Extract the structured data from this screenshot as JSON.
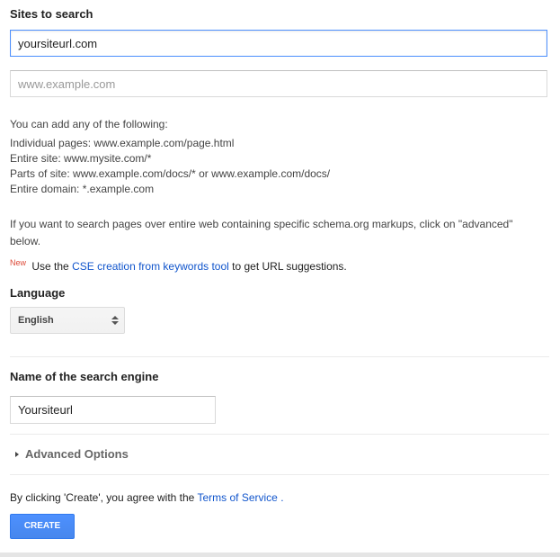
{
  "sites": {
    "title": "Sites to search",
    "site_input_value": "yoursiteurl.com",
    "new_site_placeholder": "www.example.com"
  },
  "hints": {
    "intro": "You can add any of the following:",
    "lines": [
      "Individual pages: www.example.com/page.html",
      "Entire site: www.mysite.com/*",
      "Parts of site: www.example.com/docs/* or www.example.com/docs/",
      "Entire domain: *.example.com"
    ],
    "schema_note": "If you want to search pages over entire web containing specific schema.org markups, click on \"advanced\" below."
  },
  "suggestion": {
    "badge": "New",
    "prefix": "Use the",
    "link": "CSE creation from keywords tool",
    "suffix": "to get URL suggestions."
  },
  "language": {
    "title": "Language",
    "selected": "English"
  },
  "engine_name": {
    "title": "Name of the search engine",
    "value": "Yoursiteurl"
  },
  "advanced": {
    "label": "Advanced Options"
  },
  "agreement": {
    "prefix": "By clicking 'Create', you agree with the",
    "link": "Terms of Service",
    "suffix": "."
  },
  "actions": {
    "create_label": "CREATE"
  },
  "colors": {
    "accent": "#4d90fe",
    "link": "#1155cc",
    "new_badge": "#dd4b39"
  }
}
